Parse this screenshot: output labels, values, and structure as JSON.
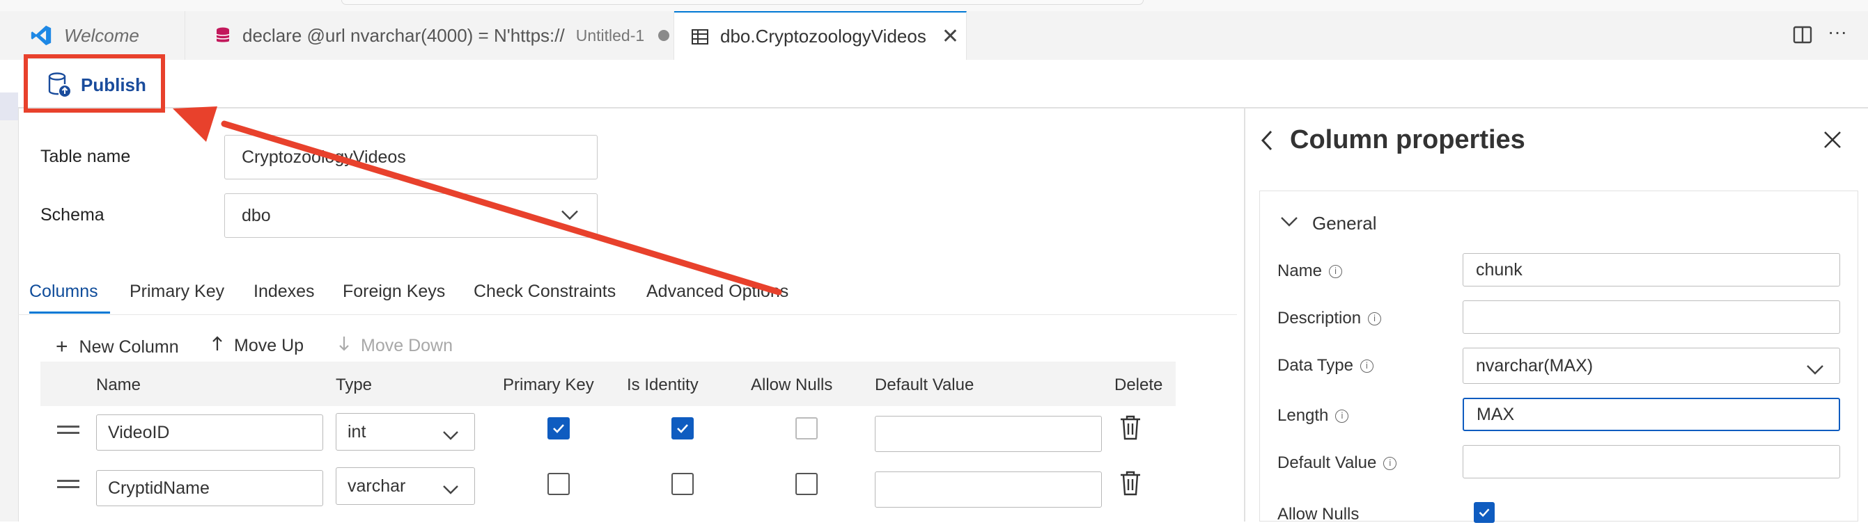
{
  "tabs": [
    {
      "label": "Welcome"
    },
    {
      "label": "declare @url nvarchar(4000) = N'https://",
      "sub": "Untitled-1"
    },
    {
      "label": "dbo.CryptozoologyVideos"
    }
  ],
  "toolbar": {
    "publish_label": "Publish"
  },
  "form": {
    "table_name_label": "Table name",
    "table_name_value": "CryptozoologyVideos",
    "schema_label": "Schema",
    "schema_value": "dbo"
  },
  "designer_tabs": [
    "Columns",
    "Primary Key",
    "Indexes",
    "Foreign Keys",
    "Check Constraints",
    "Advanced Options"
  ],
  "actions": {
    "new_column": "New Column",
    "move_up": "Move Up",
    "move_down": "Move Down"
  },
  "grid": {
    "headers": [
      "Name",
      "Type",
      "Primary Key",
      "Is Identity",
      "Allow Nulls",
      "Default Value",
      "Delete"
    ],
    "rows": [
      {
        "name": "VideoID",
        "type": "int",
        "primary_key": true,
        "is_identity": true,
        "allow_nulls": false
      },
      {
        "name": "CryptidName",
        "type": "varchar",
        "primary_key": false,
        "is_identity": false,
        "allow_nulls": false
      }
    ]
  },
  "column_properties": {
    "title": "Column properties",
    "section": "General",
    "name_label": "Name",
    "name_value": "chunk",
    "description_label": "Description",
    "description_value": "",
    "data_type_label": "Data Type",
    "data_type_value": "nvarchar(MAX)",
    "length_label": "Length",
    "length_value": "MAX",
    "default_label": "Default Value",
    "default_value": "",
    "allow_nulls_label": "Allow Nulls",
    "allow_nulls": true
  },
  "colors": {
    "accent": "#0078d4",
    "annotation": "#e8412c",
    "checkbox": "#0f5cc0"
  }
}
